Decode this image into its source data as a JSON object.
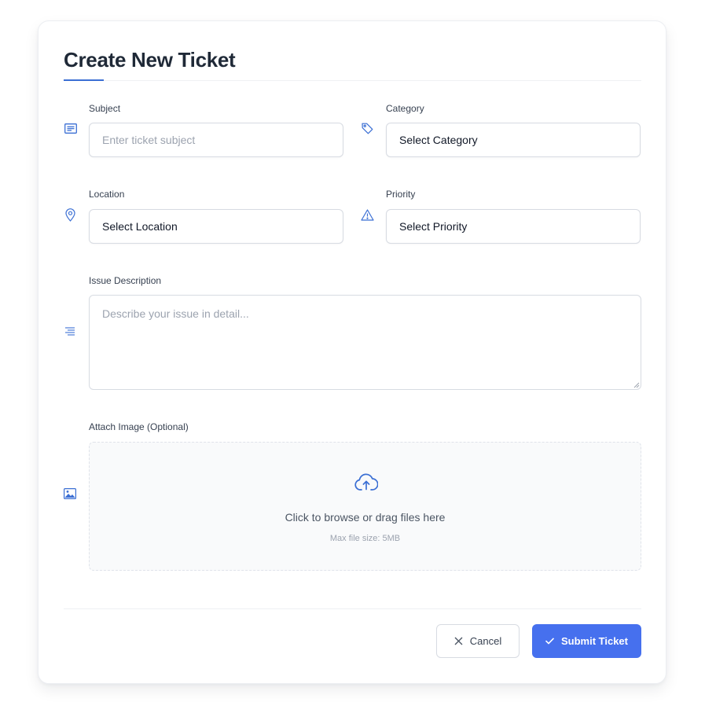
{
  "form": {
    "title": "Create New Ticket",
    "subject": {
      "label": "Subject",
      "placeholder": "Enter ticket subject",
      "icon": "message-lines-icon"
    },
    "category": {
      "label": "Category",
      "value": "Select Category",
      "icon": "tag-icon"
    },
    "location": {
      "label": "Location",
      "value": "Select Location",
      "icon": "map-pin-icon"
    },
    "priority": {
      "label": "Priority",
      "value": "Select Priority",
      "icon": "warning-triangle-icon"
    },
    "description": {
      "label": "Issue Description",
      "placeholder": "Describe your issue in detail...",
      "icon": "align-lines-icon"
    },
    "attachment": {
      "label": "Attach Image (Optional)",
      "prompt": "Click to browse or drag files here",
      "hint": "Max file size: 5MB",
      "icon": "image-icon",
      "upload_icon": "cloud-upload-icon"
    }
  },
  "actions": {
    "cancel_label": "Cancel",
    "submit_label": "Submit Ticket"
  },
  "colors": {
    "accent": "#3b6fd4",
    "primary_button": "#4670ee",
    "title": "#1f2937"
  }
}
